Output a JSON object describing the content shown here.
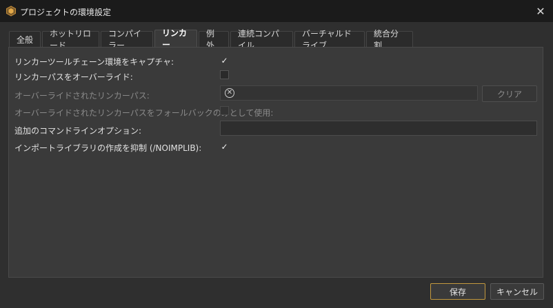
{
  "window": {
    "title": "プロジェクトの環境設定",
    "close_glyph": "✕"
  },
  "tabs": [
    {
      "label": "全般",
      "active": false
    },
    {
      "label": "ホットリロード",
      "active": false
    },
    {
      "label": "コンパイラー",
      "active": false
    },
    {
      "label": "リンカー",
      "active": true
    },
    {
      "label": "例外",
      "active": false
    },
    {
      "label": "連続コンパイル",
      "active": false
    },
    {
      "label": "バーチャルドライブ",
      "active": false
    },
    {
      "label": "統合分割",
      "active": false
    }
  ],
  "settings": {
    "capture_env": {
      "label": "リンカーツールチェーン環境をキャプチャ:",
      "checked": true
    },
    "override_linker": {
      "label": "リンカーパスをオーバーライド:",
      "checked": false
    },
    "overridden_path": {
      "label": "オーバーライドされたリンカーパス:",
      "value": "",
      "clear_label": "クリア"
    },
    "fallback_only": {
      "label": "オーバーライドされたリンカーパスをフォールバックのみとして使用:",
      "checked": false
    },
    "extra_options": {
      "label": "追加のコマンドラインオプション:",
      "value": ""
    },
    "suppress_implib": {
      "label": "インポートライブラリの作成を抑制 (/NOIMPLIB):",
      "checked": true
    }
  },
  "footer": {
    "save_label": "保存",
    "cancel_label": "キャンセル"
  },
  "colors": {
    "accent": "#c49a3e",
    "titlebar": "#1b1b1b",
    "panel": "#3a3a3a"
  }
}
